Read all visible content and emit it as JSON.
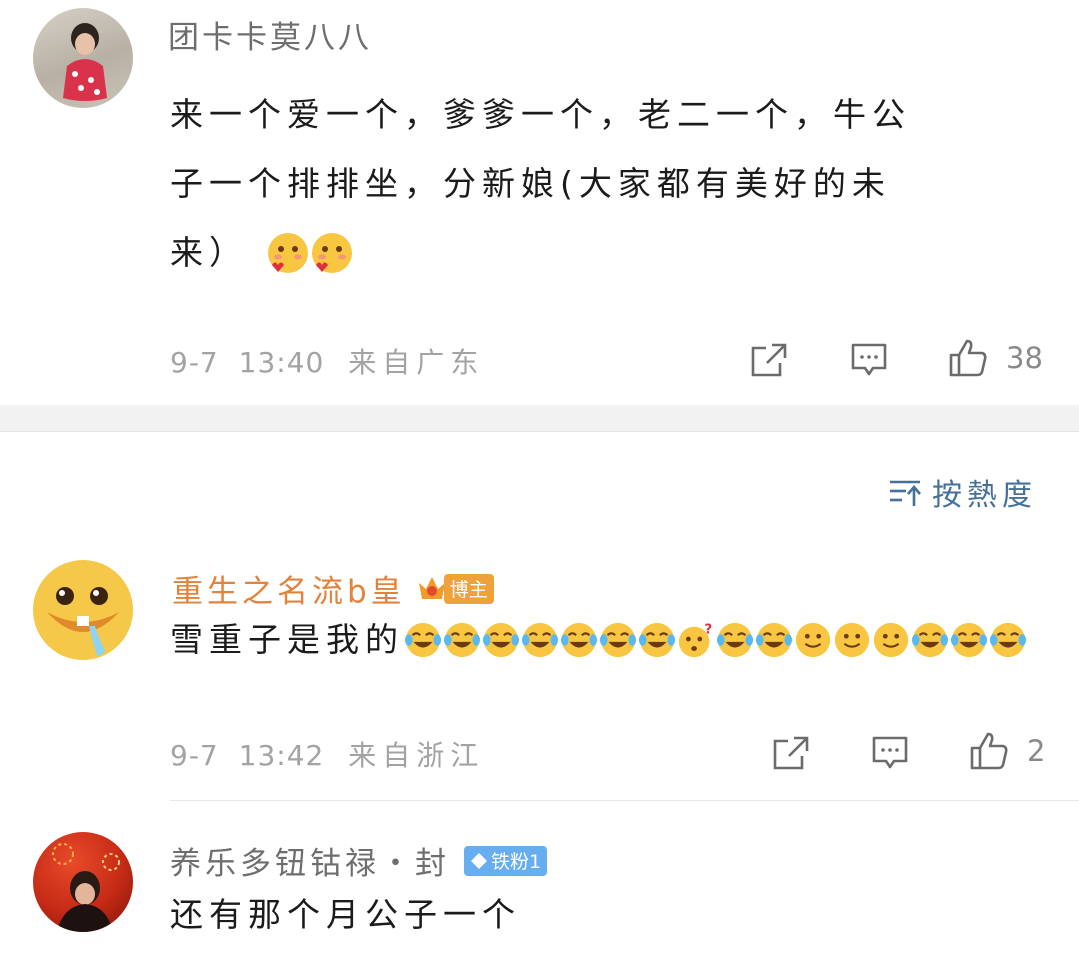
{
  "comment1": {
    "username": "团卡卡莫八八",
    "text_lines": [
      "来一个爱一个，爹爹一个，老二一个，牛公",
      "子一个排排坐，分新娘(大家都有美好的未",
      "来）"
    ],
    "trailing_emojis": [
      "blush-heart-emoji",
      "blush-heart-emoji"
    ],
    "date": "9-7",
    "time": "13:40",
    "location": "来自广东",
    "likes": "38"
  },
  "sort": {
    "label": "按熱度",
    "icon": "sort-icon"
  },
  "comment2": {
    "username": "重生之名流b皇",
    "badge": "博主",
    "text": "雪重子是我的",
    "emojis": [
      "laugh-cry",
      "laugh-cry",
      "laugh-cry",
      "laugh-cry",
      "laugh-cry",
      "laugh-cry",
      "laugh-cry",
      "confused",
      "laugh-cry",
      "laugh-cry",
      "smile",
      "smile",
      "smile",
      "laugh-cry",
      "laugh-cry",
      "laugh-cry"
    ],
    "date": "9-7",
    "time": "13:42",
    "location": "来自浙江",
    "likes": "2"
  },
  "comment3": {
    "username": "养乐多钮钴禄・封",
    "badge": "铁粉1",
    "text": "还有那个月公子一个"
  },
  "colors": {
    "username_orange": "#e3823a",
    "badge_orange": "#f0a23a",
    "badge_blue": "#66aef0",
    "separator": "#f2f2f2",
    "sort_blue": "#45709a"
  }
}
